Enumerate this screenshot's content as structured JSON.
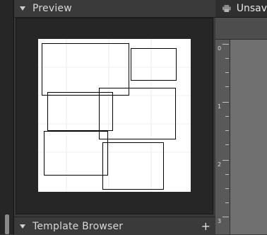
{
  "panels": {
    "preview": {
      "label": "Preview"
    },
    "template_browser": {
      "label": "Template Browser",
      "add_icon": "+"
    }
  },
  "toolbar": {
    "title": "Unsav",
    "icon": "printer-icon"
  },
  "ruler": {
    "labels": [
      "0",
      "1",
      "2",
      "3"
    ]
  },
  "colors": {
    "panel_bg": "#3a3a3a",
    "preview_bg": "#262626",
    "page": "#ffffff",
    "right_bg": "#6a6a6a"
  }
}
